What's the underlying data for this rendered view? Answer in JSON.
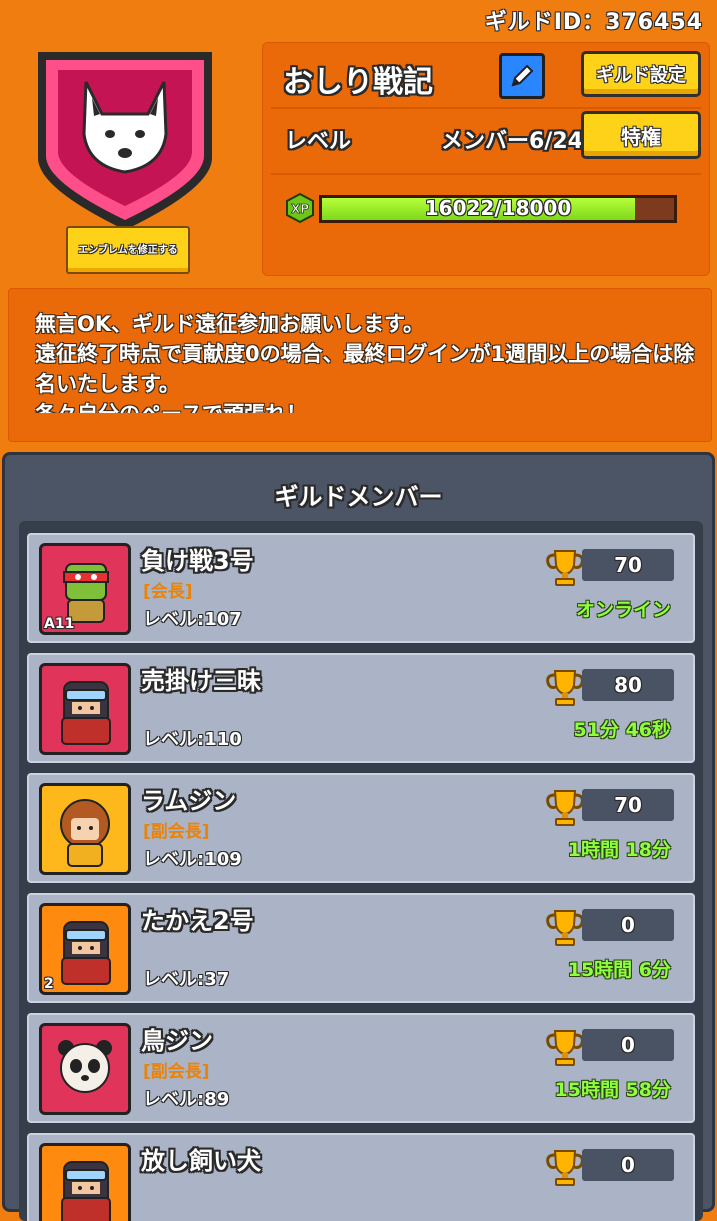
{
  "header": {
    "guild_id_text": "ギルドID：376454"
  },
  "emblem": {
    "edit_label": "エンブレムを修正する"
  },
  "guild": {
    "name": "おしり戦記",
    "settings_label": "ギルド設定",
    "level_label": "レベル",
    "member_count": "メンバー6/24",
    "privilege_label": "特権",
    "xp_label": "XP",
    "xp_text": "16022/18000",
    "xp_fraction": 0.8901
  },
  "description": "無言OK、ギルド遠征参加お願いします。\n遠征終了時点で貢献度0の場合、最終ログインが1週間以上の場合は除名いたします。\n各々自分のペースで頑張れ！",
  "members_title": "ギルドメンバー",
  "members": [
    {
      "name": "負け戦3号",
      "role": "[会長]",
      "level": "レベル:107",
      "trophies": "70",
      "status": "オンライン",
      "avatar_bg": "#e0345a",
      "avatar": "turtle-icon",
      "badge": "A11"
    },
    {
      "name": "売掛け三昧",
      "role": "",
      "level": "レベル:110",
      "trophies": "80",
      "status": "51分 46秒",
      "avatar_bg": "#e0345a",
      "avatar": "ninja-icon",
      "badge": ""
    },
    {
      "name": "ラムジン",
      "role": "[副会長]",
      "level": "レベル:109",
      "trophies": "70",
      "status": "1時間 18分",
      "avatar_bg": "#ffb81c",
      "avatar": "girl-icon",
      "badge": ""
    },
    {
      "name": "たかえ2号",
      "role": "",
      "level": "レベル:37",
      "trophies": "0",
      "status": "15時間 6分",
      "avatar_bg": "#ff8a10",
      "avatar": "ninja-icon",
      "badge": "2"
    },
    {
      "name": "鳥ジン",
      "role": "[副会長]",
      "level": "レベル:89",
      "trophies": "0",
      "status": "15時間 58分",
      "avatar_bg": "#e0345a",
      "avatar": "panda-icon",
      "badge": ""
    },
    {
      "name": "放し飼い犬",
      "role": "",
      "level": "",
      "trophies": "0",
      "status": "",
      "avatar_bg": "#ff8a10",
      "avatar": "ninja-icon",
      "badge": ""
    }
  ]
}
